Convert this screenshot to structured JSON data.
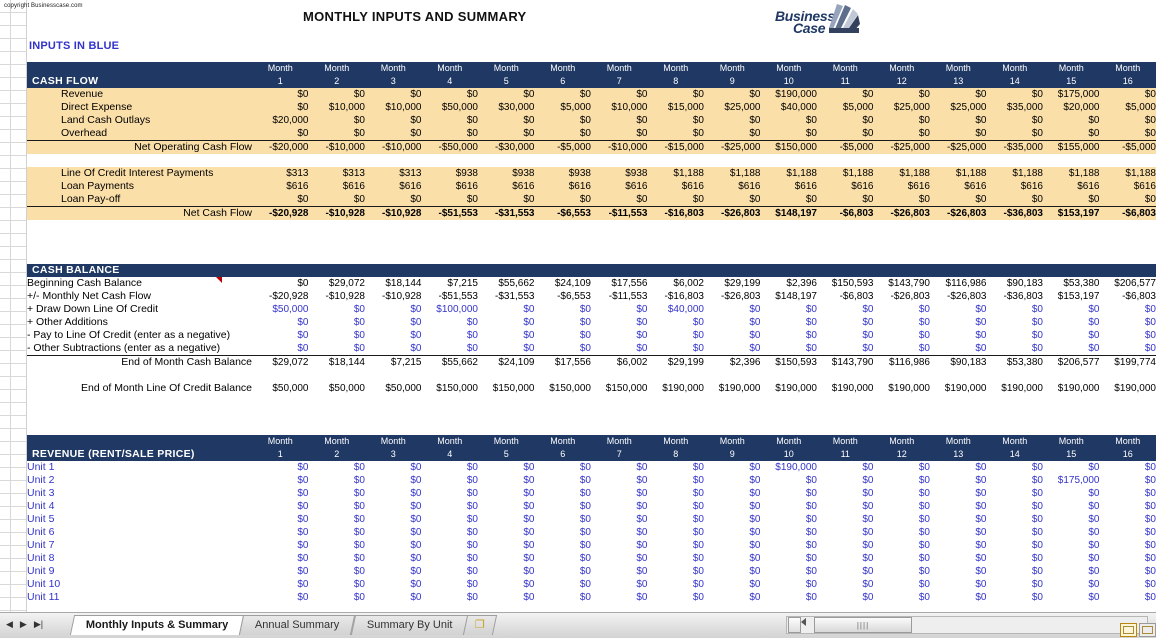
{
  "page": {
    "copyright": "copyright Businesscase.com",
    "title": "MONTHLY INPUTS AND SUMMARY",
    "inputs_note": "INPUTS IN BLUE",
    "logo_line1": "Business",
    "logo_line2": "Case",
    "accent_header": "#1f3864",
    "accent_body": "#fbdfa9",
    "input_color": "#3333cc"
  },
  "months": {
    "label": "Month",
    "numbers": [
      "1",
      "2",
      "3",
      "4",
      "5",
      "6",
      "7",
      "8",
      "9",
      "10",
      "11",
      "12",
      "13",
      "14",
      "15",
      "16"
    ]
  },
  "cash_flow": {
    "section_title": "CASH FLOW",
    "rows": [
      {
        "label": "Revenue",
        "bold": false,
        "indent": 1,
        "blue": false,
        "values": [
          "$0",
          "$0",
          "$0",
          "$0",
          "$0",
          "$0",
          "$0",
          "$0",
          "$0",
          "$190,000",
          "$0",
          "$0",
          "$0",
          "$0",
          "$175,000",
          "$0"
        ]
      },
      {
        "label": "Direct Expense",
        "bold": false,
        "indent": 1,
        "blue": false,
        "values": [
          "$0",
          "$10,000",
          "$10,000",
          "$50,000",
          "$30,000",
          "$5,000",
          "$10,000",
          "$15,000",
          "$25,000",
          "$40,000",
          "$5,000",
          "$25,000",
          "$25,000",
          "$35,000",
          "$20,000",
          "$5,000"
        ]
      },
      {
        "label": "Land Cash Outlays",
        "bold": false,
        "indent": 1,
        "blue": false,
        "values": [
          "$20,000",
          "$0",
          "$0",
          "$0",
          "$0",
          "$0",
          "$0",
          "$0",
          "$0",
          "$0",
          "$0",
          "$0",
          "$0",
          "$0",
          "$0",
          "$0"
        ]
      },
      {
        "label": "Overhead",
        "bold": false,
        "indent": 1,
        "blue": false,
        "values": [
          "$0",
          "$0",
          "$0",
          "$0",
          "$0",
          "$0",
          "$0",
          "$0",
          "$0",
          "$0",
          "$0",
          "$0",
          "$0",
          "$0",
          "$0",
          "$0"
        ]
      },
      {
        "label": "Net Operating Cash Flow",
        "bold": false,
        "indent": 0,
        "align": "right",
        "topline": true,
        "blue": false,
        "values": [
          "-$20,000",
          "-$10,000",
          "-$10,000",
          "-$50,000",
          "-$30,000",
          "-$5,000",
          "-$10,000",
          "-$15,000",
          "-$25,000",
          "$150,000",
          "-$5,000",
          "-$25,000",
          "-$25,000",
          "-$35,000",
          "$155,000",
          "-$5,000"
        ]
      },
      {
        "spacer": true
      },
      {
        "label": "Line Of Credit Interest Payments",
        "bold": false,
        "indent": 1,
        "blue": false,
        "values": [
          "$313",
          "$313",
          "$313",
          "$938",
          "$938",
          "$938",
          "$938",
          "$1,188",
          "$1,188",
          "$1,188",
          "$1,188",
          "$1,188",
          "$1,188",
          "$1,188",
          "$1,188",
          "$1,188"
        ]
      },
      {
        "label": "Loan Payments",
        "bold": false,
        "indent": 1,
        "blue": false,
        "values": [
          "$616",
          "$616",
          "$616",
          "$616",
          "$616",
          "$616",
          "$616",
          "$616",
          "$616",
          "$616",
          "$616",
          "$616",
          "$616",
          "$616",
          "$616",
          "$616"
        ]
      },
      {
        "label": "Loan Pay-off",
        "bold": false,
        "indent": 1,
        "blue": false,
        "values": [
          "$0",
          "$0",
          "$0",
          "$0",
          "$0",
          "$0",
          "$0",
          "$0",
          "$0",
          "$0",
          "$0",
          "$0",
          "$0",
          "$0",
          "$0",
          "$0"
        ]
      },
      {
        "label": "Net Cash Flow",
        "bold": true,
        "indent": 0,
        "align": "right",
        "topline": true,
        "blue": false,
        "values": [
          "-$20,928",
          "-$10,928",
          "-$10,928",
          "-$51,553",
          "-$31,553",
          "-$6,553",
          "-$11,553",
          "-$16,803",
          "-$26,803",
          "$148,197",
          "-$6,803",
          "-$26,803",
          "-$26,803",
          "-$36,803",
          "$153,197",
          "-$6,803"
        ]
      }
    ]
  },
  "cash_balance": {
    "section_title": "CASH BALANCE",
    "rows": [
      {
        "label": "Beginning Cash Balance",
        "indent": 0,
        "blue": false,
        "values": [
          "$0",
          "$29,072",
          "$18,144",
          "$7,215",
          "$55,662",
          "$24,109",
          "$17,556",
          "$6,002",
          "$29,199",
          "$2,396",
          "$150,593",
          "$143,790",
          "$116,986",
          "$90,183",
          "$53,380",
          "$206,577"
        ]
      },
      {
        "label": "+/- Monthly Net Cash Flow",
        "indent": 0,
        "blue": false,
        "values": [
          "-$20,928",
          "-$10,928",
          "-$10,928",
          "-$51,553",
          "-$31,553",
          "-$6,553",
          "-$11,553",
          "-$16,803",
          "-$26,803",
          "$148,197",
          "-$6,803",
          "-$26,803",
          "-$26,803",
          "-$36,803",
          "$153,197",
          "-$6,803"
        ]
      },
      {
        "label": "+  Draw Down Line Of Credit",
        "indent": 0,
        "blue": true,
        "values": [
          "$50,000",
          "$0",
          "$0",
          "$100,000",
          "$0",
          "$0",
          "$0",
          "$40,000",
          "$0",
          "$0",
          "$0",
          "$0",
          "$0",
          "$0",
          "$0",
          "$0"
        ]
      },
      {
        "label": "+  Other Additions",
        "indent": 0,
        "blue": true,
        "values": [
          "$0",
          "$0",
          "$0",
          "$0",
          "$0",
          "$0",
          "$0",
          "$0",
          "$0",
          "$0",
          "$0",
          "$0",
          "$0",
          "$0",
          "$0",
          "$0"
        ]
      },
      {
        "label": "-   Pay to Line Of Credit (enter as a negative)",
        "indent": 0,
        "blue": true,
        "values": [
          "$0",
          "$0",
          "$0",
          "$0",
          "$0",
          "$0",
          "$0",
          "$0",
          "$0",
          "$0",
          "$0",
          "$0",
          "$0",
          "$0",
          "$0",
          "$0"
        ]
      },
      {
        "label": "-   Other Subtractions (enter as a negative)",
        "indent": 0,
        "blue": true,
        "values": [
          "$0",
          "$0",
          "$0",
          "$0",
          "$0",
          "$0",
          "$0",
          "$0",
          "$0",
          "$0",
          "$0",
          "$0",
          "$0",
          "$0",
          "$0",
          "$0"
        ]
      },
      {
        "label": "End of Month Cash Balance",
        "indent": 0,
        "align": "right",
        "topline": true,
        "blue": false,
        "values": [
          "$29,072",
          "$18,144",
          "$7,215",
          "$55,662",
          "$24,109",
          "$17,556",
          "$6,002",
          "$29,199",
          "$2,396",
          "$150,593",
          "$143,790",
          "$116,986",
          "$90,183",
          "$53,380",
          "$206,577",
          "$199,774"
        ]
      },
      {
        "spacer": true
      },
      {
        "label": "End of Month Line Of Credit Balance",
        "indent": 0,
        "align": "right",
        "blue": false,
        "values": [
          "$50,000",
          "$50,000",
          "$50,000",
          "$150,000",
          "$150,000",
          "$150,000",
          "$150,000",
          "$190,000",
          "$190,000",
          "$190,000",
          "$190,000",
          "$190,000",
          "$190,000",
          "$190,000",
          "$190,000",
          "$190,000"
        ]
      }
    ]
  },
  "revenue": {
    "section_title": "REVENUE (RENT/SALE PRICE)",
    "rows": [
      {
        "label": "Unit 1",
        "values": [
          "$0",
          "$0",
          "$0",
          "$0",
          "$0",
          "$0",
          "$0",
          "$0",
          "$0",
          "$190,000",
          "$0",
          "$0",
          "$0",
          "$0",
          "$0",
          "$0"
        ]
      },
      {
        "label": "Unit 2",
        "values": [
          "$0",
          "$0",
          "$0",
          "$0",
          "$0",
          "$0",
          "$0",
          "$0",
          "$0",
          "$0",
          "$0",
          "$0",
          "$0",
          "$0",
          "$175,000",
          "$0"
        ]
      },
      {
        "label": "Unit 3",
        "values": [
          "$0",
          "$0",
          "$0",
          "$0",
          "$0",
          "$0",
          "$0",
          "$0",
          "$0",
          "$0",
          "$0",
          "$0",
          "$0",
          "$0",
          "$0",
          "$0"
        ]
      },
      {
        "label": "Unit 4",
        "values": [
          "$0",
          "$0",
          "$0",
          "$0",
          "$0",
          "$0",
          "$0",
          "$0",
          "$0",
          "$0",
          "$0",
          "$0",
          "$0",
          "$0",
          "$0",
          "$0"
        ]
      },
      {
        "label": "Unit 5",
        "values": [
          "$0",
          "$0",
          "$0",
          "$0",
          "$0",
          "$0",
          "$0",
          "$0",
          "$0",
          "$0",
          "$0",
          "$0",
          "$0",
          "$0",
          "$0",
          "$0"
        ]
      },
      {
        "label": "Unit 6",
        "values": [
          "$0",
          "$0",
          "$0",
          "$0",
          "$0",
          "$0",
          "$0",
          "$0",
          "$0",
          "$0",
          "$0",
          "$0",
          "$0",
          "$0",
          "$0",
          "$0"
        ]
      },
      {
        "label": "Unit 7",
        "values": [
          "$0",
          "$0",
          "$0",
          "$0",
          "$0",
          "$0",
          "$0",
          "$0",
          "$0",
          "$0",
          "$0",
          "$0",
          "$0",
          "$0",
          "$0",
          "$0"
        ]
      },
      {
        "label": "Unit 8",
        "values": [
          "$0",
          "$0",
          "$0",
          "$0",
          "$0",
          "$0",
          "$0",
          "$0",
          "$0",
          "$0",
          "$0",
          "$0",
          "$0",
          "$0",
          "$0",
          "$0"
        ]
      },
      {
        "label": "Unit 9",
        "values": [
          "$0",
          "$0",
          "$0",
          "$0",
          "$0",
          "$0",
          "$0",
          "$0",
          "$0",
          "$0",
          "$0",
          "$0",
          "$0",
          "$0",
          "$0",
          "$0"
        ]
      },
      {
        "label": "Unit 10",
        "values": [
          "$0",
          "$0",
          "$0",
          "$0",
          "$0",
          "$0",
          "$0",
          "$0",
          "$0",
          "$0",
          "$0",
          "$0",
          "$0",
          "$0",
          "$0",
          "$0"
        ]
      },
      {
        "label": "Unit 11",
        "values": [
          "$0",
          "$0",
          "$0",
          "$0",
          "$0",
          "$0",
          "$0",
          "$0",
          "$0",
          "$0",
          "$0",
          "$0",
          "$0",
          "$0",
          "$0",
          "$0"
        ]
      }
    ]
  },
  "sheet_tabs": {
    "nav_first": "|◀",
    "nav_prev": "◀",
    "nav_next": "▶",
    "nav_last": "▶|",
    "tabs": [
      {
        "label": "Monthly Inputs & Summary",
        "active": true
      },
      {
        "label": "Annual Summary",
        "active": false
      },
      {
        "label": "Summary By Unit",
        "active": false
      }
    ],
    "new_sheet_icon": "❐"
  },
  "scrollbar": {
    "thumb_grip": "||||"
  }
}
